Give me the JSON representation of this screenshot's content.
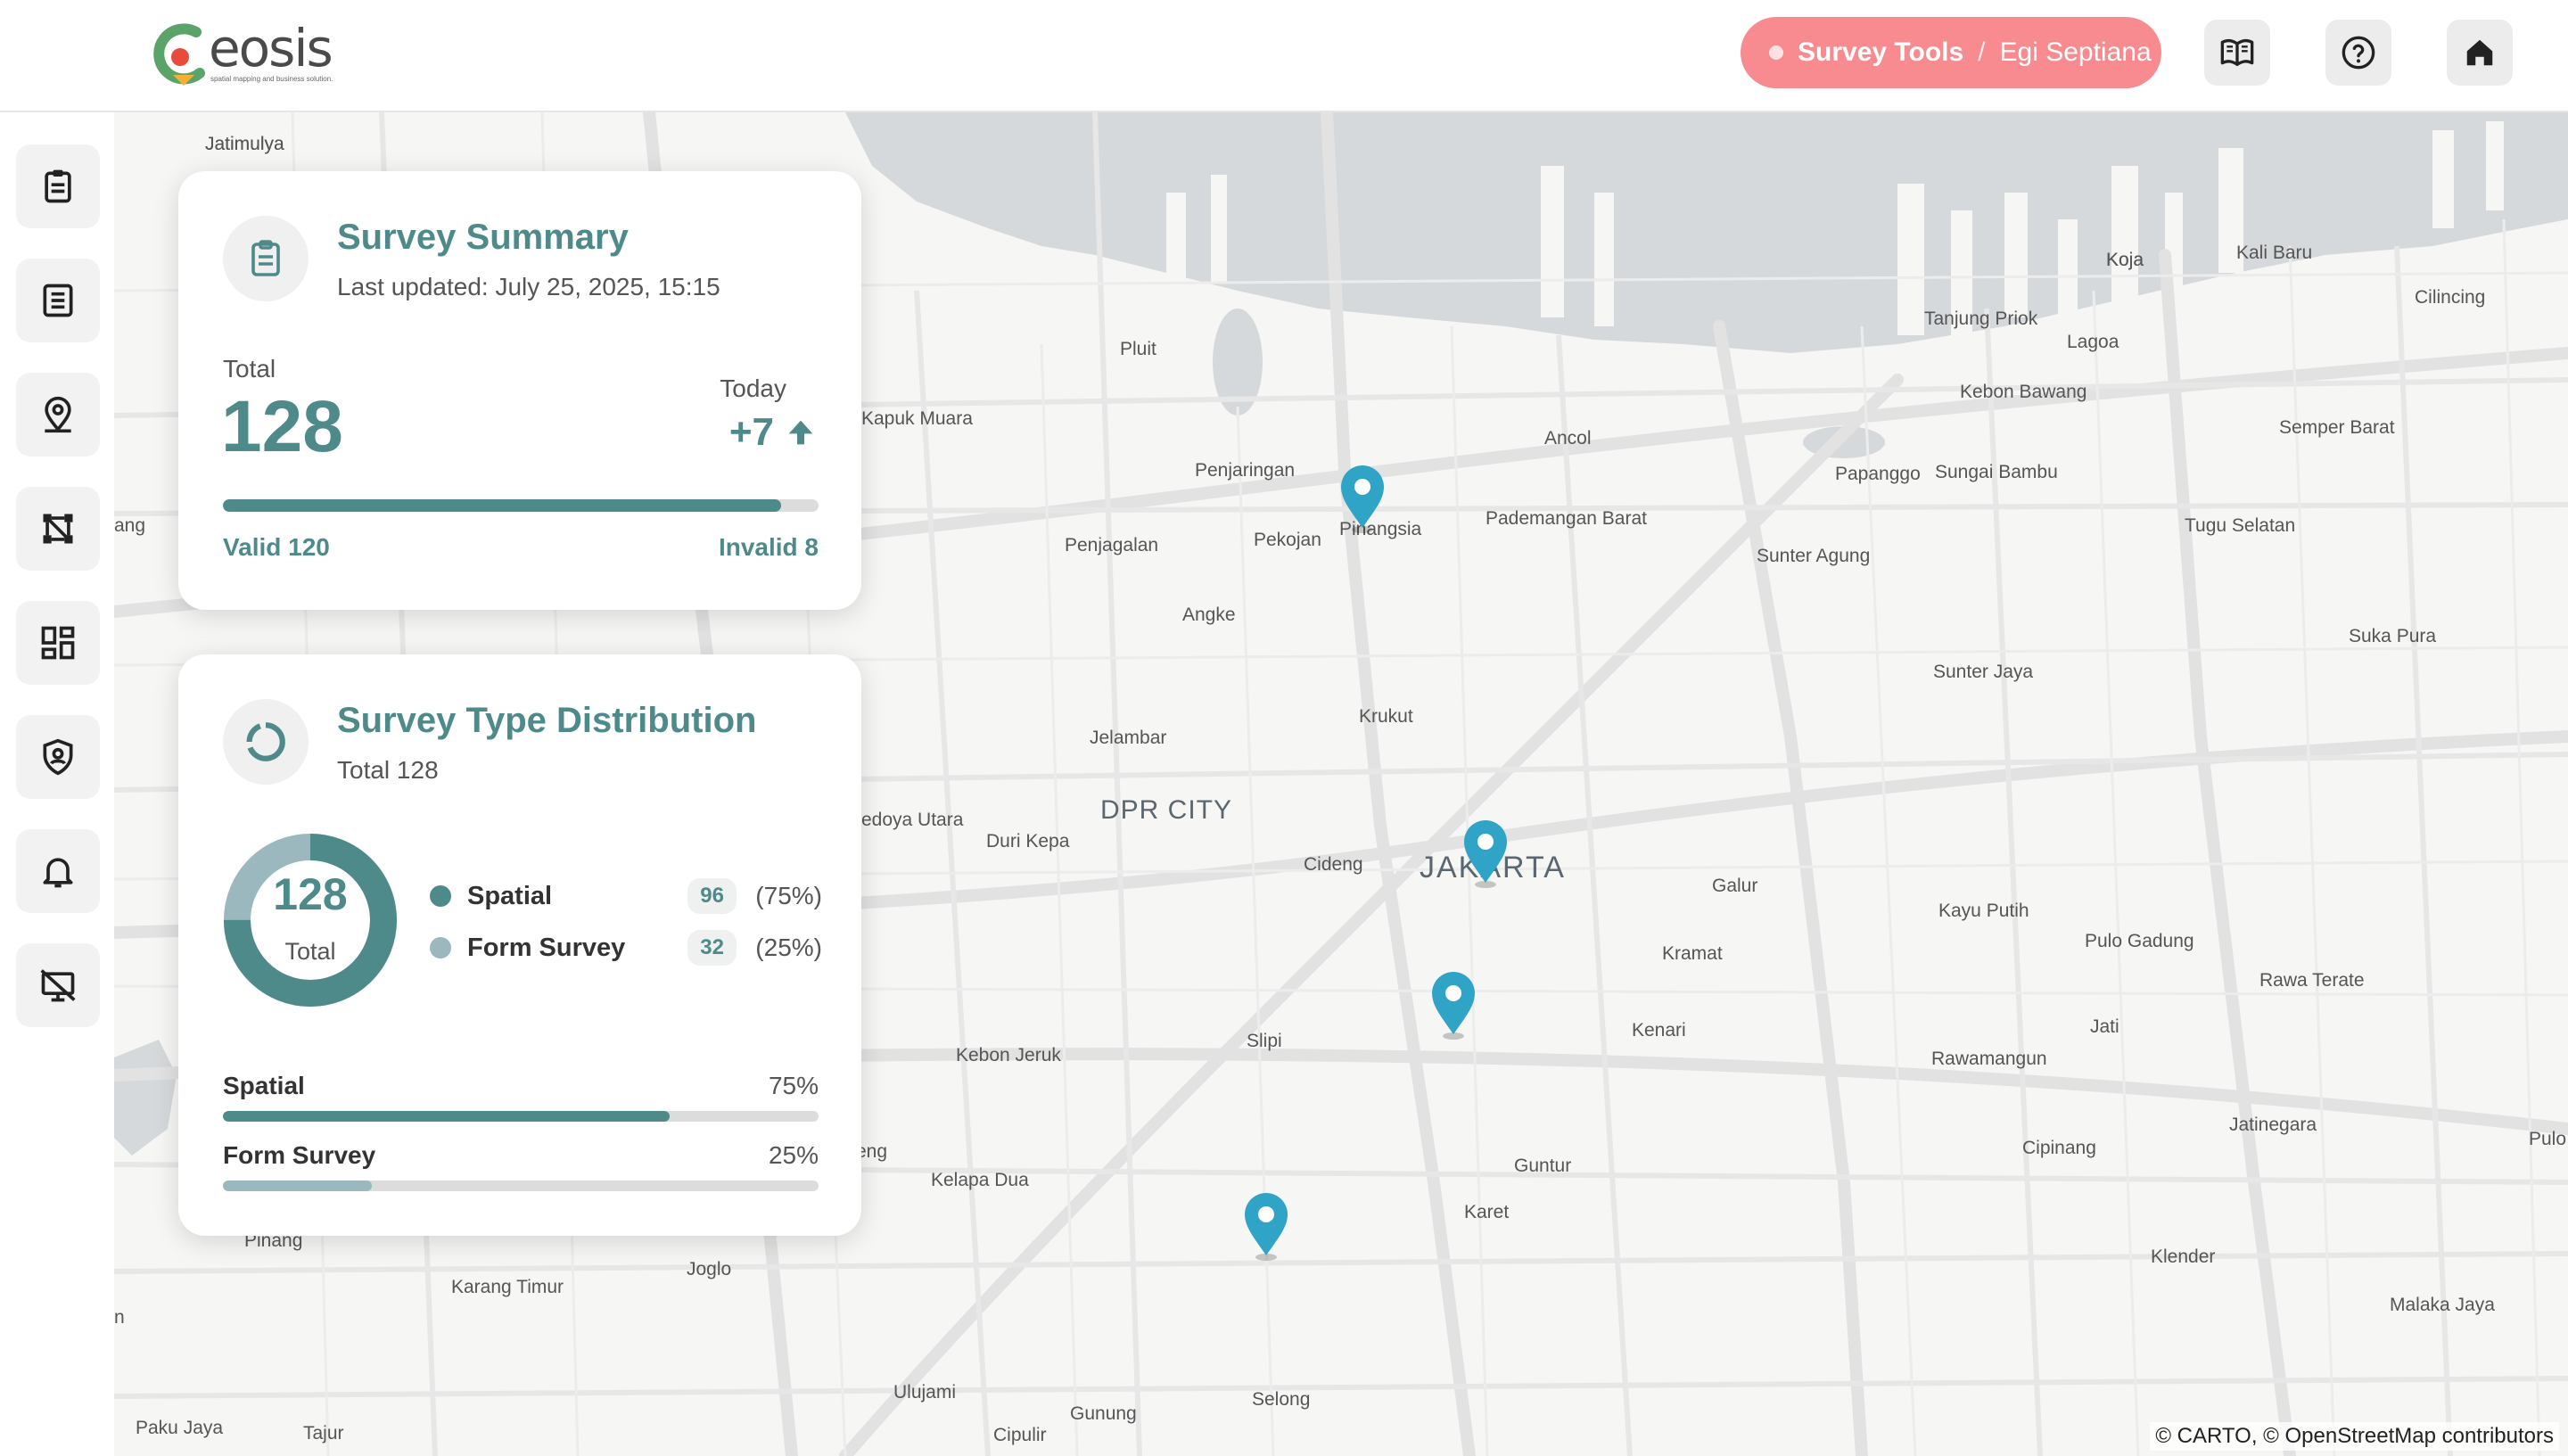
{
  "header": {
    "logo_word": "eosis",
    "logo_tagline": "spatial mapping and business solution.",
    "breadcrumb_app": "Survey Tools",
    "breadcrumb_sep": "/",
    "breadcrumb_user": "Egi Septiana"
  },
  "summary": {
    "title": "Survey Summary",
    "updated": "Last updated: July 25, 2025, 15:15",
    "total_label": "Total",
    "total_value": "128",
    "today_label": "Today",
    "today_value": "+7",
    "valid_label": "Valid 120",
    "invalid_label": "Invalid 8",
    "valid_fraction": 0.9375
  },
  "distribution": {
    "title": "Survey Type Distribution",
    "subtitle": "Total 128",
    "donut_value": "128",
    "donut_label": "Total",
    "items": [
      {
        "name": "Spatial",
        "count": "96",
        "pct": "(75%)",
        "bar_pct": "75%",
        "fraction": 0.75,
        "color": "#4f8a8b"
      },
      {
        "name": "Form Survey",
        "count": "32",
        "pct": "(25%)",
        "bar_pct": "25%",
        "fraction": 0.25,
        "color": "#9ab8bd"
      }
    ]
  },
  "map": {
    "attribution": "© CARTO, © OpenStreetMap contributors",
    "labels": [
      "Jatimulya",
      "Koja",
      "Kali Baru",
      "Cilincing",
      "Tanjung Priok",
      "Lagoa",
      "Pluit",
      "Kebon Bawang",
      "Semper Barat",
      "Kapuk Muara",
      "Ancol",
      "Papanggo",
      "Sungai Bambu",
      "Penjaringan",
      "Pinangsia",
      "Pademangan Barat",
      "Tugu Selatan",
      "Penjagalan",
      "Pekojan",
      "Sunter Agung",
      "Angke",
      "Suka Pura",
      "Sunter Jaya",
      "Krukut",
      "Jelambar",
      "DPR CITY",
      "Kedoya Utara",
      "Duri Kepa",
      "Cideng",
      "JAKARTA",
      "Galur",
      "Kayu Putih",
      "Pulo Gadung",
      "Kramat",
      "Rawa Terate",
      "Kenari",
      "Jati",
      "Slipi",
      "Kebon Jeruk",
      "Rawamangun",
      "Jatinegara",
      "Kelapa Dua",
      "Guntur",
      "Cipinang",
      "Pulo",
      "Karet",
      "Pinang",
      "Klender",
      "Joglo",
      "Karang Timur",
      "Malaka Jaya",
      "Ulujami",
      "Selong",
      "Paku Jaya",
      "Tajur",
      "Gunung",
      "Cipulir",
      "ang",
      "eng",
      "n"
    ]
  },
  "colors": {
    "accent": "#4f8a8b",
    "accent_light": "#9ab8bd",
    "breadcrumb": "#f78b90",
    "pin": "#2fa4c7"
  }
}
